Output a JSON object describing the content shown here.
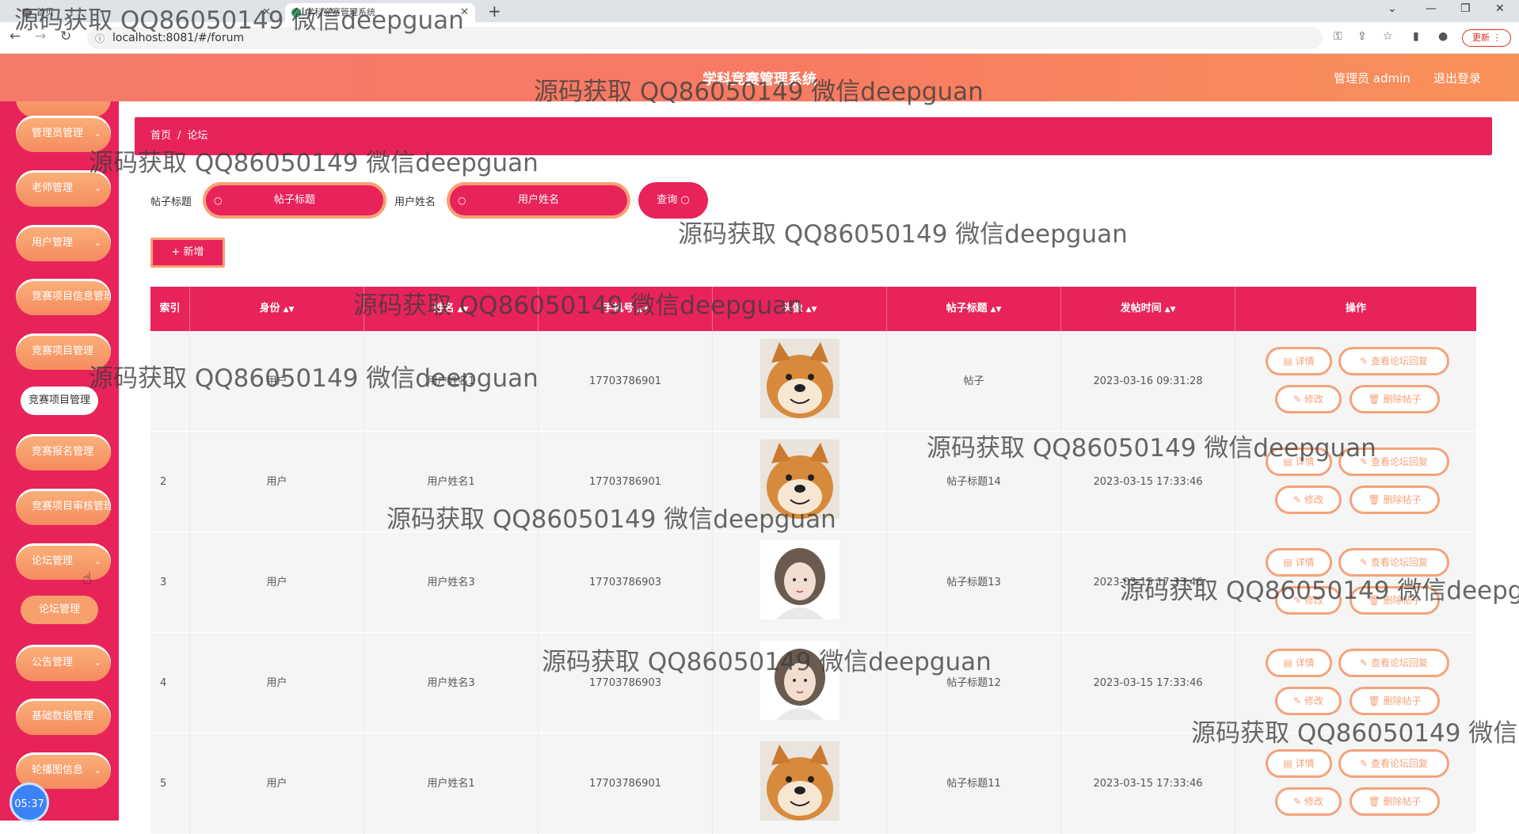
{
  "browser": {
    "tabs": [
      {
        "title": "首页"
      },
      {
        "title": "学科竞赛管理系统"
      }
    ],
    "url": "localhost:8081/#/forum",
    "update_label": "更新"
  },
  "header": {
    "title": "学科竞赛管理系统",
    "admin_label": "管理员 admin",
    "logout_label": "退出登录"
  },
  "sidebar": {
    "items": [
      {
        "label": "管理员管理"
      },
      {
        "label": "老师管理"
      },
      {
        "label": "用户管理"
      },
      {
        "label": "竞赛项目信息管理"
      },
      {
        "label": "竞赛项目管理"
      },
      {
        "label": "竞赛报名管理"
      },
      {
        "label": "竞赛项目审核管理"
      },
      {
        "label": "论坛管理"
      },
      {
        "label": "公告管理"
      },
      {
        "label": "基础数据管理"
      },
      {
        "label": "轮播图信息"
      }
    ],
    "sub_items": [
      {
        "label": "竞赛项目管理"
      },
      {
        "label": "论坛管理"
      }
    ],
    "clock": "05:37"
  },
  "breadcrumb": {
    "home": "首页",
    "sep": "/",
    "current": "论坛"
  },
  "search": {
    "title_label": "帖子标题",
    "title_placeholder": "帖子标题",
    "user_label": "用户姓名",
    "user_placeholder": "用户姓名",
    "query_label": "查询"
  },
  "add_label": "+ 新增",
  "table": {
    "columns": [
      "索引",
      "身份",
      "姓名",
      "手机号",
      "头像",
      "帖子标题",
      "发帖时间",
      "操作"
    ],
    "rows": [
      {
        "index": "",
        "role": "用户",
        "name": "用户姓名1",
        "phone": "17703786901",
        "avatar": "dog",
        "title": "帖子",
        "time": "2023-03-16 09:31:28"
      },
      {
        "index": "2",
        "role": "用户",
        "name": "用户姓名1",
        "phone": "17703786901",
        "avatar": "dog",
        "title": "帖子标题14",
        "time": "2023-03-15 17:33:46"
      },
      {
        "index": "3",
        "role": "用户",
        "name": "用户姓名3",
        "phone": "17703786903",
        "avatar": "girl",
        "title": "帖子标题13",
        "time": "2023-03-15 17:33:46"
      },
      {
        "index": "4",
        "role": "用户",
        "name": "用户姓名3",
        "phone": "17703786903",
        "avatar": "girl",
        "title": "帖子标题12",
        "time": "2023-03-15 17:33:46"
      },
      {
        "index": "5",
        "role": "用户",
        "name": "用户姓名1",
        "phone": "17703786901",
        "avatar": "dog",
        "title": "帖子标题11",
        "time": "2023-03-15 17:33:46"
      }
    ],
    "actions": {
      "detail": "详情",
      "view_replies": "查看论坛回复",
      "edit": "修改",
      "delete": "删除帖子"
    }
  },
  "watermark": "源码获取 QQ86050149 微信deepguan",
  "colors": {
    "primary": "#e8235a",
    "accent": "#f7a074",
    "header_start": "#f47b6a"
  }
}
